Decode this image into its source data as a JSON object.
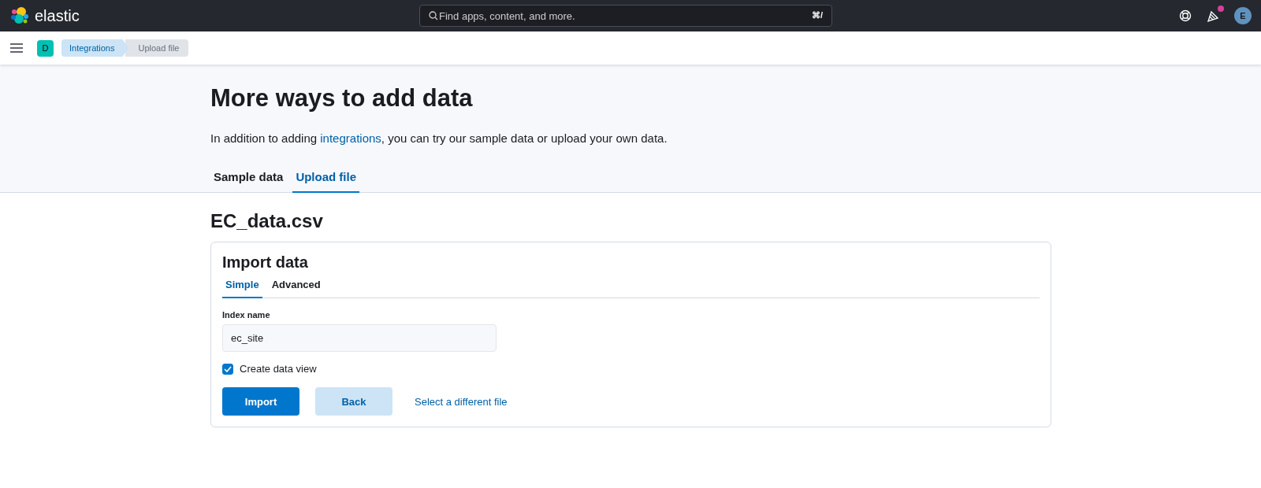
{
  "header": {
    "logo_text": "elastic",
    "search": {
      "placeholder": "Find apps, content, and more.",
      "shortcut": "⌘/"
    },
    "notification": true,
    "avatar": "E"
  },
  "breadcrumbs_bar": {
    "space_badge": "D",
    "breadcrumbs": [
      {
        "label": "Integrations",
        "selected": false
      },
      {
        "label": "Upload file",
        "selected": true
      }
    ]
  },
  "page": {
    "title": "More ways to add data",
    "intro": {
      "before": "In addition to adding ",
      "link": "integrations",
      "after": ", you can try our sample data or upload your own data."
    },
    "tabs": [
      {
        "label": "Sample data",
        "selected": false
      },
      {
        "label": "Upload file",
        "selected": true
      }
    ]
  },
  "file_title": "EC_data.csv",
  "import_panel": {
    "title": "Import data",
    "tabs": [
      {
        "label": "Simple",
        "selected": true
      },
      {
        "label": "Advanced",
        "selected": false
      }
    ],
    "index_name": {
      "label": "Index name",
      "value": "ec_site"
    },
    "create_data_view": {
      "label": "Create data view",
      "checked": true
    },
    "buttons": [
      {
        "label": "Import",
        "kind": "primary"
      },
      {
        "label": "Back",
        "kind": "secondary"
      }
    ],
    "link": "Select a different file"
  }
}
